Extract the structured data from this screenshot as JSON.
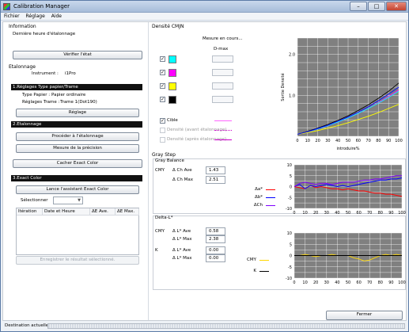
{
  "window": {
    "title": "Calibration Manager",
    "minimize": "–",
    "maximize": "□",
    "close": "✕"
  },
  "menu": [
    "Fichier",
    "Réglage",
    "Aide"
  ],
  "information": {
    "heading": "Information",
    "last_calibration_label": "Dernière heure d'étalonnage",
    "verify_button": "Vérifier l'état"
  },
  "etalonnage": {
    "heading": "Etalonnage",
    "instrument_label": "Instrument :",
    "instrument_value": "i1Pro",
    "section1_title": "1.Réglages Type papier/Trame",
    "paper_type_label": "Type Papier :",
    "paper_type_value": "Papier ordinaire",
    "screen_setting_label": "Réglages Trame :",
    "screen_setting_value": "Trame 1(Dot190)",
    "reglage_button": "Réglage",
    "section2_title": "2.Etalonnage",
    "proceed_button": "Procéder à l'étalonnage",
    "measure_button": "Mesure de la précision",
    "hide_exact_color_button": "Cacher Exact Color",
    "section3_title": "3.Exact Color",
    "launch_assistant_button": "Lance l'assistant Exact Color",
    "select_label": "Sélectionner",
    "select_value": "",
    "table_headers": [
      "Itération",
      "Date et Heure",
      "ΔE Ave.",
      "ΔE Max."
    ],
    "save_result_button": "Enregistrer le résultat sélectionné."
  },
  "densite": {
    "heading": "Densité CMJN",
    "measuring": "Mesure en cours...",
    "dmax_label": "D-max",
    "channels": [
      {
        "name": "C",
        "color": "#00ffff",
        "checked": true,
        "value": ""
      },
      {
        "name": "M",
        "color": "#ff00ff",
        "checked": true,
        "value": ""
      },
      {
        "name": "Y",
        "color": "#ffff00",
        "checked": true,
        "value": ""
      },
      {
        "name": "K",
        "color": "#000000",
        "checked": true,
        "value": ""
      }
    ],
    "legend": [
      {
        "label": "Cible",
        "checked": true,
        "enabled": true,
        "color": "#ff66ff",
        "dash": "solid"
      },
      {
        "label": "Densité (avant étalonnage)",
        "checked": false,
        "enabled": false,
        "color": "#cc00cc",
        "dash": "dotted"
      },
      {
        "label": "Densité (après étalonnage)",
        "checked": false,
        "enabled": false,
        "color": "#cc00cc",
        "dash": "solid"
      }
    ]
  },
  "gray_step": {
    "heading": "Gray Step",
    "balance_title": "Gray Balance",
    "cmy_label": "CMY",
    "ch_ave_label": "Δ Ch Ave",
    "ch_ave_value": "1.43",
    "ch_max_label": "Δ Ch Max",
    "ch_max_value": "2.51",
    "balance_legend": [
      {
        "label": "Δa*",
        "color": "#ff0000"
      },
      {
        "label": "Δb*",
        "color": "#0000ff"
      },
      {
        "label": "ΔCh",
        "color": "#8000ff"
      }
    ],
    "delta_l_title": "Delta-L*",
    "delta_l": [
      {
        "group": "CMY",
        "ave_label": "Δ L* Ave",
        "ave_value": "0.58",
        "max_label": "Δ L* Max",
        "max_value": "2.38"
      },
      {
        "group": "K",
        "ave_label": "Δ L* Ave",
        "ave_value": "0.00",
        "max_label": "Δ L* Max",
        "max_value": "0.00"
      }
    ],
    "delta_l_legend": [
      {
        "label": "CMY",
        "color": "#ffd700"
      },
      {
        "label": "K",
        "color": "#000000"
      }
    ]
  },
  "close_button": "Fermer",
  "status_text": "Destination actuelle",
  "chart_data": [
    {
      "type": "line",
      "title": "Densité CMJN",
      "xlabel": "introduire%",
      "ylabel": "Sortie Densité",
      "x": [
        0,
        10,
        20,
        30,
        40,
        50,
        60,
        70,
        80,
        90,
        100
      ],
      "xlim": [
        0,
        100
      ],
      "ylim": [
        0,
        2.4
      ],
      "yticks": [
        1.0,
        2.0
      ],
      "grid": true,
      "series": [
        {
          "color": "#000000",
          "values": [
            0.05,
            0.12,
            0.2,
            0.29,
            0.39,
            0.5,
            0.63,
            0.77,
            0.93,
            1.1,
            1.3
          ]
        },
        {
          "color": "#ff00ff",
          "values": [
            0.05,
            0.11,
            0.18,
            0.26,
            0.35,
            0.45,
            0.56,
            0.68,
            0.82,
            0.97,
            1.13
          ]
        },
        {
          "color": "#00ffff",
          "values": [
            0.05,
            0.11,
            0.18,
            0.26,
            0.35,
            0.45,
            0.56,
            0.68,
            0.81,
            0.95,
            1.1
          ]
        },
        {
          "color": "#ffff00",
          "values": [
            0.05,
            0.09,
            0.14,
            0.2,
            0.26,
            0.33,
            0.41,
            0.49,
            0.58,
            0.68,
            0.78
          ]
        },
        {
          "color": "#0000ff",
          "values": [
            0.05,
            0.11,
            0.19,
            0.27,
            0.37,
            0.47,
            0.59,
            0.72,
            0.87,
            1.03,
            1.2
          ]
        }
      ]
    },
    {
      "type": "line",
      "title": "Gray Balance",
      "x": [
        0,
        5,
        10,
        15,
        20,
        25,
        30,
        35,
        40,
        45,
        50,
        55,
        60,
        65,
        70,
        75,
        80,
        85,
        90,
        95,
        100
      ],
      "xlim": [
        0,
        100
      ],
      "ylim": [
        -10,
        10
      ],
      "yticks": [
        -10,
        -5,
        0,
        5,
        10
      ],
      "grid": true,
      "series": [
        {
          "name": "Δa*",
          "color": "#ff0000",
          "values": [
            0,
            -0.5,
            -1,
            0.5,
            -0.5,
            0,
            -0.5,
            -1,
            -1,
            -1.5,
            -1,
            -1.5,
            -2,
            -2,
            -2.5,
            -3,
            -3,
            -3.5,
            -3.5,
            -4,
            -4.5
          ]
        },
        {
          "name": "Δb*",
          "color": "#0000ff",
          "values": [
            0,
            1,
            -1,
            0.5,
            0,
            0.5,
            1,
            0.5,
            0,
            0.5,
            0,
            0.5,
            1,
            1.5,
            2,
            2.5,
            3,
            3,
            3.5,
            3.5,
            4
          ]
        },
        {
          "name": "ΔCh",
          "color": "#8000ff",
          "values": [
            0,
            1.5,
            2,
            1.5,
            1,
            1.5,
            1.5,
            1,
            1.5,
            2,
            2,
            2,
            2.5,
            3,
            3,
            3.5,
            3.5,
            4,
            4.5,
            5,
            5
          ]
        }
      ]
    },
    {
      "type": "line",
      "title": "Delta-L*",
      "x": [
        0,
        5,
        10,
        15,
        20,
        25,
        30,
        35,
        40,
        45,
        50,
        55,
        60,
        65,
        70,
        75,
        80,
        85,
        90,
        95,
        100
      ],
      "xlim": [
        0,
        100
      ],
      "ylim": [
        -10,
        10
      ],
      "yticks": [
        -10,
        -5,
        0,
        5,
        10
      ],
      "grid": true,
      "series": [
        {
          "name": "CMY",
          "color": "#ffd700",
          "values": [
            0,
            0,
            0.5,
            0,
            -0.5,
            0,
            0,
            0.5,
            0,
            0,
            0,
            -1,
            -1.5,
            -2.4,
            -2,
            -1,
            0,
            0.5,
            0,
            0.5,
            0
          ]
        },
        {
          "name": "K",
          "color": "#000000",
          "values": [
            0,
            0,
            0,
            0,
            0,
            0,
            0,
            0,
            0,
            0,
            0,
            0,
            0,
            0,
            0,
            0,
            0,
            0,
            0,
            0,
            0
          ]
        }
      ]
    }
  ]
}
